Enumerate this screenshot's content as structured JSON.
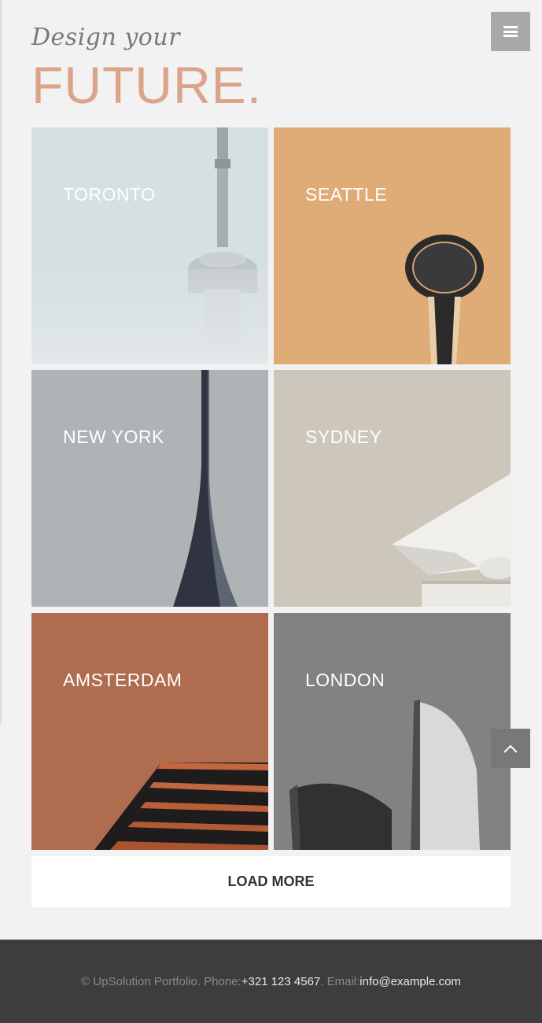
{
  "header": {
    "tagline": "Design your",
    "headline": "FUTURE.",
    "menu_icon": "hamburger-icon"
  },
  "portfolio": {
    "items": [
      {
        "label": "TORONTO",
        "bg": "#d6dfe2"
      },
      {
        "label": "SEATTLE",
        "bg": "#dfab76"
      },
      {
        "label": "NEW YORK",
        "bg": "#aeb3b5"
      },
      {
        "label": "SYDNEY",
        "bg": "#ccc6bb"
      },
      {
        "label": "AMSTERDAM",
        "bg": "#b06c4f"
      },
      {
        "label": "LONDON",
        "bg": "#818381"
      }
    ],
    "load_more": "LOAD MORE"
  },
  "to_top_icon": "chevron-up-icon",
  "footer": {
    "copyright": "© UpSolution Portfolio. Phone: ",
    "phone": "+321 123 4567",
    "email_label": ". Email: ",
    "email": "info@example.com"
  },
  "colors": {
    "accent": "#dba48a",
    "footer_bg": "#3d3d3d"
  }
}
